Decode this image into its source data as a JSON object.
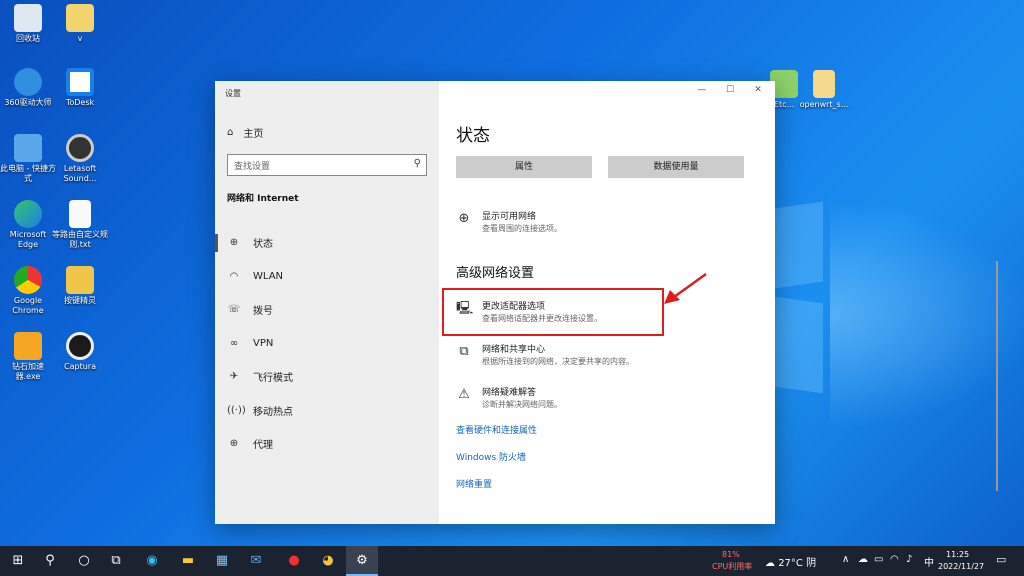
{
  "desktop": {
    "icons": [
      {
        "label": "回收站"
      },
      {
        "label": "v"
      },
      {
        "label": "360驱动大师"
      },
      {
        "label": "ToDesk"
      },
      {
        "label": "此电脑 - 快捷方式"
      },
      {
        "label": "Letasoft Sound..."
      },
      {
        "label": "Microsoft Edge"
      },
      {
        "label": "等路由自定义规则.txt"
      },
      {
        "label": "Google Chrome"
      },
      {
        "label": "按键精灵"
      },
      {
        "label": "钻石加速器.exe"
      },
      {
        "label": "Captura"
      },
      {
        "label": "Etc..."
      },
      {
        "label": "openwrt_s..."
      }
    ]
  },
  "window": {
    "title": "设置",
    "controls": {
      "minimize": "—",
      "maximize": "☐",
      "close": "✕"
    },
    "sidebar": {
      "home_label": "主页",
      "search_placeholder": "查找设置",
      "section_title": "网络和 Internet",
      "items": [
        {
          "label": "状态",
          "icon": "globe-icon"
        },
        {
          "label": "WLAN",
          "icon": "wifi-icon"
        },
        {
          "label": "拨号",
          "icon": "dialup-icon"
        },
        {
          "label": "VPN",
          "icon": "vpn-icon"
        },
        {
          "label": "飞行模式",
          "icon": "airplane-icon"
        },
        {
          "label": "移动热点",
          "icon": "hotspot-icon"
        },
        {
          "label": "代理",
          "icon": "globe-icon"
        }
      ]
    },
    "main": {
      "title": "状态",
      "buttons": {
        "properties": "属性",
        "data_usage": "数据使用量"
      },
      "show_networks": {
        "title": "显示可用网络",
        "desc": "查看周围的连接选项。"
      },
      "advanced_title": "高级网络设置",
      "adapter": {
        "title": "更改适配器选项",
        "desc": "查看网络适配器并更改连接设置。"
      },
      "sharing": {
        "title": "网络和共享中心",
        "desc": "根据所连接到的网络，决定要共享的内容。"
      },
      "troubleshoot": {
        "title": "网络疑难解答",
        "desc": "诊断并解决网络问题。"
      },
      "links": {
        "hardware": "查看硬件和连接属性",
        "firewall": "Windows 防火墙",
        "reset": "网络重置"
      }
    }
  },
  "taskbar": {
    "cpu_percent": "81%",
    "cpu_label": "CPU利用率",
    "weather": "27°C 阴",
    "ime": "中",
    "time": "11:25",
    "date": "2022/11/27"
  },
  "colors": {
    "highlight": "#e21b1b",
    "link": "#1a64b6",
    "taskbar": "#1c2330"
  }
}
